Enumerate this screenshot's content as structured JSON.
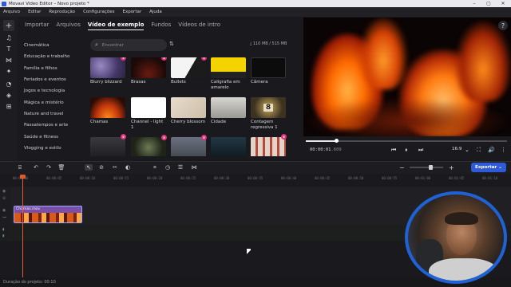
{
  "window": {
    "title": "Movavi Video Editor – Novo projeto *",
    "min": "–",
    "max": "▢",
    "close": "✕"
  },
  "menu": [
    "Arquivo",
    "Editar",
    "Reprodução",
    "Configurações",
    "Exportar",
    "Ajuda"
  ],
  "tabs": [
    {
      "label": "Importar",
      "active": false
    },
    {
      "label": "Arquivos",
      "active": false
    },
    {
      "label": "Vídeo de exemplo",
      "active": true
    },
    {
      "label": "Fundos",
      "active": false
    },
    {
      "label": "Vídeos de intro",
      "active": false
    }
  ],
  "categories": [
    "Cinemática",
    "Educação e trabalho",
    "Família e filhos",
    "Feriados e eventos",
    "Jogos e tecnologia",
    "Mágica e mistério",
    "Nature and travel",
    "Passatempos e arte",
    "Saúde e fitness",
    "Vlogging e estilo"
  ],
  "search": {
    "placeholder": "Encontrar"
  },
  "storage": "110 MB / 515 MB",
  "media": [
    {
      "label": "Blurry blizzard",
      "badge": true
    },
    {
      "label": "Brasas",
      "badge": true
    },
    {
      "label": "Bullets",
      "badge": true
    },
    {
      "label": "Caligrafia em amarelo",
      "badge": false
    },
    {
      "label": "Câmera",
      "badge": false
    },
    {
      "label": "Chamas",
      "badge": false
    },
    {
      "label": "Channel - light 1",
      "badge": true
    },
    {
      "label": "Cherry blossom",
      "badge": true
    },
    {
      "label": "Cidade",
      "badge": false
    },
    {
      "label": "Contagem regressiva 1",
      "badge": false
    },
    {
      "label": "",
      "badge": true
    },
    {
      "label": "",
      "badge": false
    },
    {
      "label": "",
      "badge": false
    },
    {
      "label": "",
      "badge": false
    },
    {
      "label": "",
      "badge": true
    }
  ],
  "countdown_digit": "8",
  "player": {
    "time": "00:00:01",
    "ms": ".609",
    "aspect": "16:9",
    "progress": 0.15
  },
  "timeline": {
    "ruler": [
      "00:00:00",
      "00:00:05",
      "00:00:10",
      "00:00:15",
      "00:00:20",
      "00:00:25",
      "00:00:30",
      "00:00:35",
      "00:00:40",
      "00:00:45",
      "00:00:50",
      "00:00:55",
      "00:01:00",
      "00:01:05",
      "00:01:10"
    ],
    "clip_name": "Chamas.mov",
    "zoom_level": 0.62
  },
  "export_label": "Exportar",
  "status": "Duração do projeto: 00:10",
  "icons": {
    "add": "+",
    "help": "?",
    "search": "⌕"
  }
}
